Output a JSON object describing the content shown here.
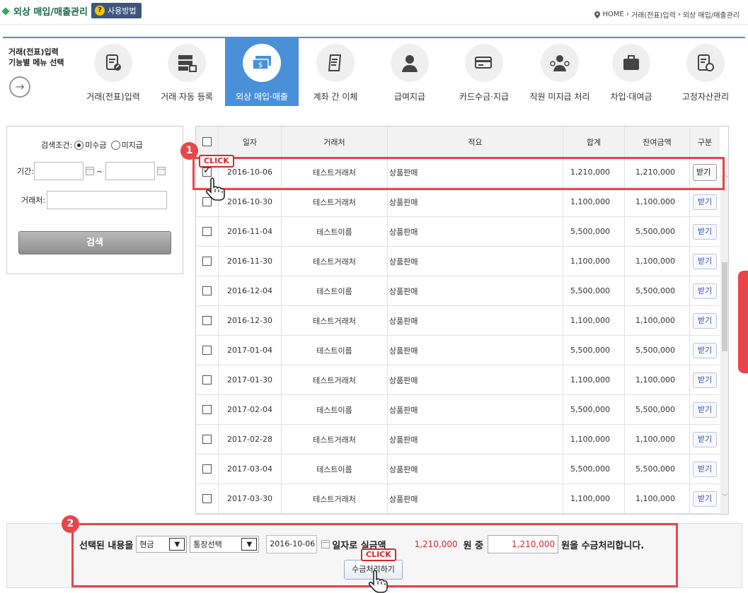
{
  "header": {
    "title": "외상 매입/매출관리",
    "help_label": "사용방법",
    "breadcrumb": [
      "HOME",
      "거래(전표)입력",
      "외상 매입/매출관리"
    ]
  },
  "menu": {
    "intro_line1": "거래(전표)입력",
    "intro_line2": "기능별 메뉴 선택",
    "items": [
      {
        "label": "거래(전표)입력",
        "icon": "document-edit-icon"
      },
      {
        "label": "거래 자동 등록",
        "icon": "server-icon"
      },
      {
        "label": "외상 매입·매출",
        "icon": "money-transfer-icon",
        "active": true
      },
      {
        "label": "계좌 간 이체",
        "icon": "document-icon"
      },
      {
        "label": "급여지급",
        "icon": "person-icon"
      },
      {
        "label": "카드수금·지급",
        "icon": "credit-card-icon"
      },
      {
        "label": "직원 미지급 처리",
        "icon": "employee-icon"
      },
      {
        "label": "차입·대여금",
        "icon": "briefcase-icon"
      },
      {
        "label": "고정자산관리",
        "icon": "asset-document-icon"
      }
    ]
  },
  "search": {
    "condition_label": "검색조건:",
    "options": [
      "미수금",
      "미지급"
    ],
    "selected": "미수금",
    "period_label": "기간:",
    "period_sep": "~",
    "partner_label": "거래처:",
    "button": "검색"
  },
  "table": {
    "headers": [
      "일자",
      "거래처",
      "적요",
      "합계",
      "잔여금액",
      "구분"
    ],
    "rows": [
      {
        "checked": true,
        "date": "2016-10-06",
        "partner": "테스트거래처",
        "desc": "상품판매",
        "total": "1,210,000",
        "remaining": "1,210,000",
        "action": "받기"
      },
      {
        "checked": false,
        "date": "2016-10-30",
        "partner": "테스트거래처",
        "desc": "상품판매",
        "total": "1,100,000",
        "remaining": "1,100,000",
        "action": "받기"
      },
      {
        "checked": false,
        "date": "2016-11-04",
        "partner": "테스트이름",
        "desc": "상품판매",
        "total": "5,500,000",
        "remaining": "5,500,000",
        "action": "받기"
      },
      {
        "checked": false,
        "date": "2016-11-30",
        "partner": "테스트거래처",
        "desc": "상품판매",
        "total": "1,100,000",
        "remaining": "1,100,000",
        "action": "받기"
      },
      {
        "checked": false,
        "date": "2016-12-04",
        "partner": "테스트이름",
        "desc": "상품판매",
        "total": "5,500,000",
        "remaining": "5,500,000",
        "action": "받기"
      },
      {
        "checked": false,
        "date": "2016-12-30",
        "partner": "테스트거래처",
        "desc": "상품판매",
        "total": "1,100,000",
        "remaining": "1,100,000",
        "action": "받기"
      },
      {
        "checked": false,
        "date": "2017-01-04",
        "partner": "테스트이름",
        "desc": "상품판매",
        "total": "5,500,000",
        "remaining": "5,500,000",
        "action": "받기"
      },
      {
        "checked": false,
        "date": "2017-01-30",
        "partner": "테스트거래처",
        "desc": "상품판매",
        "total": "1,100,000",
        "remaining": "1,100,000",
        "action": "받기"
      },
      {
        "checked": false,
        "date": "2017-02-04",
        "partner": "테스트이름",
        "desc": "상품판매",
        "total": "5,500,000",
        "remaining": "5,500,000",
        "action": "받기"
      },
      {
        "checked": false,
        "date": "2017-02-28",
        "partner": "테스트거래처",
        "desc": "상품판매",
        "total": "1,100,000",
        "remaining": "1,100,000",
        "action": "받기"
      },
      {
        "checked": false,
        "date": "2017-03-04",
        "partner": "테스트이름",
        "desc": "상품판매",
        "total": "5,500,000",
        "remaining": "5,500,000",
        "action": "받기"
      },
      {
        "checked": false,
        "date": "2017-03-30",
        "partner": "테스트거래처",
        "desc": "상품판매",
        "total": "1,100,000",
        "remaining": "1,100,000",
        "action": "받기"
      }
    ]
  },
  "annotations": {
    "step1": "1",
    "step2": "2",
    "click": "CLICK",
    "accent_color": "#e8454a"
  },
  "bottom": {
    "prefix": "선택된 내용을",
    "method": "현금",
    "account": "통장선택",
    "date": "2016-10-06",
    "date_suffix": "일자로 실금액",
    "amount": "1,210,000",
    "of_label": "원 중",
    "input_amount": "1,210,000",
    "suffix": "원을 수금처리합니다.",
    "button": "수금처리하기"
  }
}
